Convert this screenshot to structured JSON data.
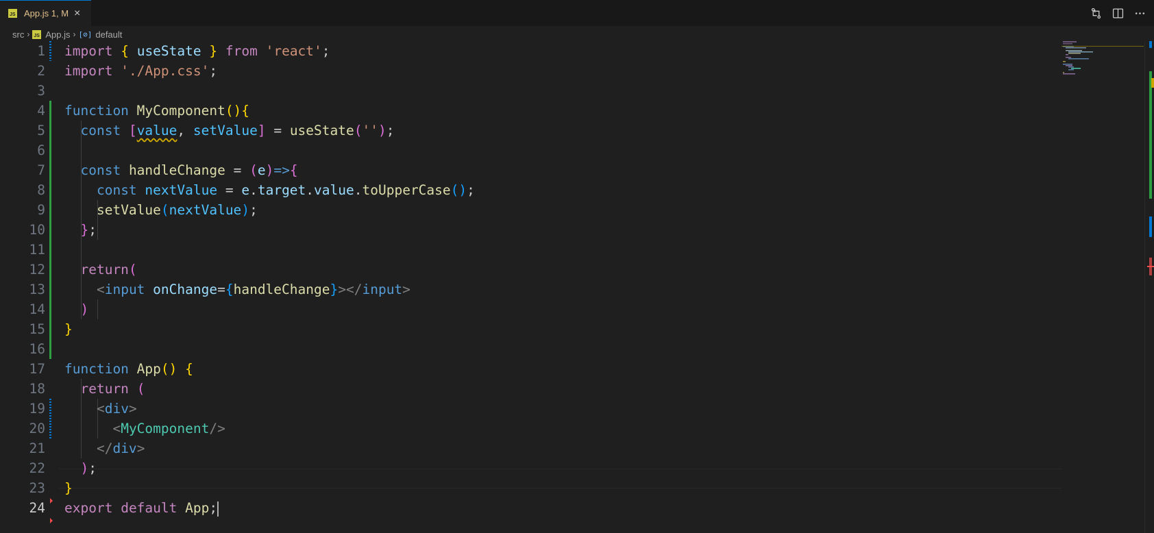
{
  "tab": {
    "badge": "JS",
    "label": "App.js 1, M",
    "close_glyph": "×"
  },
  "breadcrumbs": {
    "folder": "src",
    "file_badge": "JS",
    "file": "App.js",
    "symbol_glyph": "[⊘]",
    "symbol": "default"
  },
  "editor": {
    "active_line": 24
  },
  "colors": {
    "accent": "#0078d4",
    "added": "#2ea043",
    "modified": "#0078d4",
    "error": "#f14c4c",
    "warning": "#cca700"
  }
}
